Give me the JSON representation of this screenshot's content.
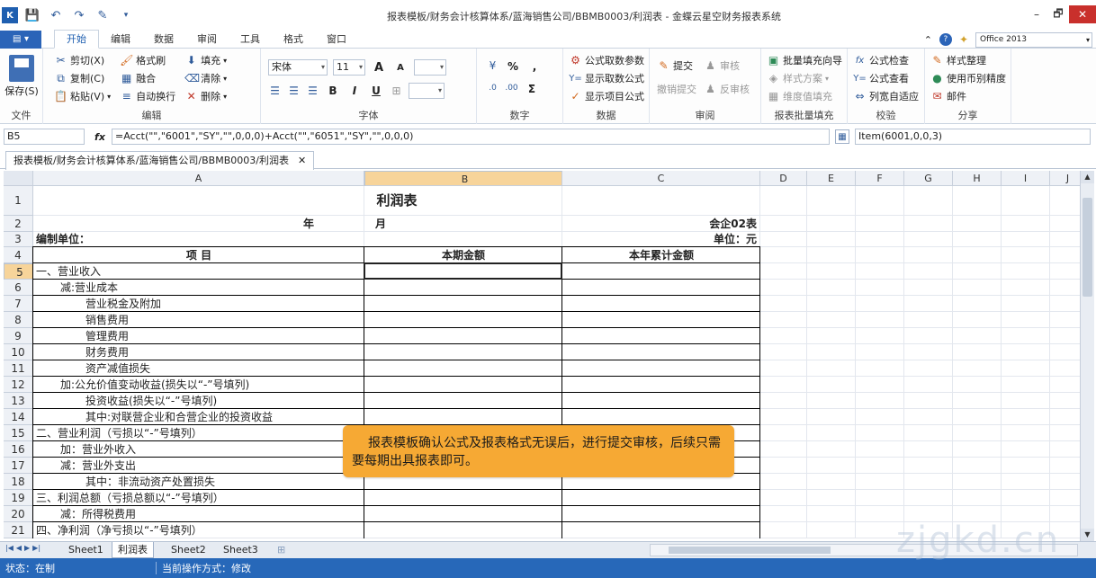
{
  "window": {
    "title": "报表模板/财务会计核算体系/蓝海销售公司/BBMB0003/利润表 - 金蝶云星空财务报表系统",
    "min": "–",
    "restore": "🗗",
    "close": "✕"
  },
  "qat": {
    "logo": "K",
    "save_icon": "💾",
    "undo_icon": "↶",
    "redo_icon": "↷",
    "brush_icon": "✎",
    "more_icon": "▾"
  },
  "tabs": {
    "file": "▤ ▾",
    "items": [
      "开始",
      "编辑",
      "数据",
      "审阅",
      "工具",
      "格式",
      "窗口"
    ],
    "style": "Office 2013",
    "up_icon": "⌃",
    "help_icon": "?"
  },
  "ribbon": {
    "file": {
      "label": "文件",
      "save": "保存(S)"
    },
    "edit": {
      "label": "编辑",
      "cut": "剪切(X)",
      "copy": "复制(C)",
      "paste": "粘贴(V)",
      "format_painter": "格式刷",
      "merge": "融合",
      "wrap": "自动换行",
      "fill": "填充",
      "clear": "清除",
      "delete": "删除"
    },
    "font": {
      "label": "字体",
      "name": "宋体",
      "size": "11",
      "grow": "A",
      "shrink": "A",
      "bold": "B",
      "italic": "I",
      "underline": "U"
    },
    "number": {
      "label": "数字",
      "percent": "%",
      "comma": ",",
      "sigma": "Σ"
    },
    "data": {
      "label": "数据",
      "fetch_params": "公式取数参数",
      "show_fetch": "显示取数公式",
      "show_item": "显示项目公式"
    },
    "review": {
      "label": "审阅",
      "submit": "提交",
      "audit": "审核",
      "cancel_submit": "撤销提交",
      "unaudit": "反审核"
    },
    "batch": {
      "label": "报表批量填充",
      "wizard": "批量填充向导",
      "scheme": "样式方案",
      "dim_fill": "维度值填充"
    },
    "check": {
      "label": "校验",
      "formula_check": "公式检查",
      "formula_view": "公式查看",
      "autofit": "列宽自适应"
    },
    "share": {
      "label": "分享",
      "style_arrange": "样式整理",
      "currency_precision": "使用币别精度",
      "mail": "邮件"
    }
  },
  "formula_bar": {
    "cell": "B5",
    "fx": "fx",
    "formula": "=Acct(\"\",\"6001\",\"SY\",\"\",0,0,0)+Acct(\"\",\"6051\",\"SY\",\"\",0,0,0)",
    "item_formula": "Item(6001,0,0,3)"
  },
  "doc_tab": {
    "label": "报表模板/财务会计核算体系/蓝海销售公司/BBMB0003/利润表",
    "close": "✕"
  },
  "columns": [
    "A",
    "B",
    "C",
    "D",
    "E",
    "F",
    "G",
    "H",
    "I",
    "J"
  ],
  "rows": [
    "1",
    "2",
    "3",
    "4",
    "5",
    "6",
    "7",
    "8",
    "9",
    "10",
    "11",
    "12",
    "13",
    "14",
    "15",
    "16",
    "17",
    "18",
    "19",
    "20",
    "21"
  ],
  "sheet": {
    "title": "利润表",
    "year": "年",
    "month": "月",
    "form_no": "会企02表",
    "unit_prefix": "编制单位：",
    "unit": "单位：元",
    "header_item": "项          目",
    "header_current": "本期金额",
    "header_ytd": "本年累计金额",
    "items": [
      "一、营业收入",
      "减:营业成本",
      "营业税金及附加",
      "销售费用",
      "管理费用",
      "财务费用",
      "资产减值损失",
      "加:公允价值变动收益(损失以“-”号填列)",
      "投资收益(损失以“-”号填列)",
      "其中:对联营企业和合营企业的投资收益",
      "二、营业利润（亏损以“-”号填列）",
      "加：营业外收入",
      "减：营业外支出",
      "其中：非流动资产处置损失",
      "三、利润总额（亏损总额以“-”号填列）",
      "减：所得税费用",
      "四、净利润（净亏损以“-”号填列）"
    ]
  },
  "note": "报表模板确认公式及报表格式无误后，进行提交审核，后续只需要每期出具报表即可。",
  "sheet_tabs": [
    "Sheet1",
    "利润表",
    "Sheet2",
    "Sheet3"
  ],
  "nav": [
    "|◀",
    "◀",
    "▶",
    "▶|"
  ],
  "status": {
    "state": "状态：在制",
    "mode": "当前操作方式：修改"
  },
  "watermark": "zjgkd.cn"
}
